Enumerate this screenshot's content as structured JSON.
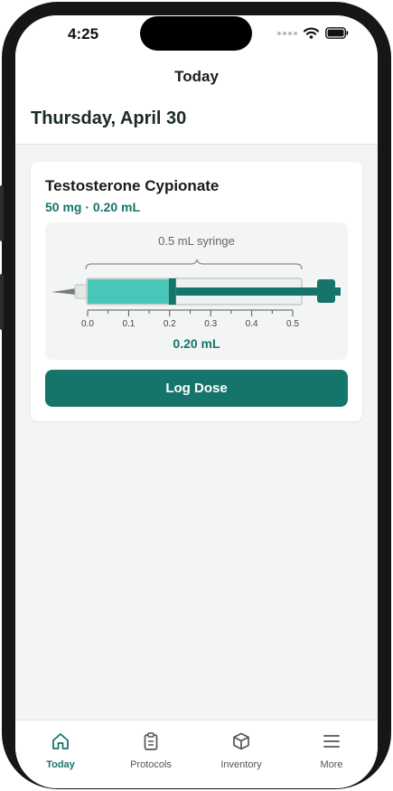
{
  "status": {
    "time": "4:25"
  },
  "nav": {
    "title": "Today"
  },
  "date": "Thursday, April 30",
  "dose_card": {
    "medication": "Testosterone Cypionate",
    "dose_line": "50 mg · 0.20 mL",
    "syringe": {
      "label": "0.5 mL syringe",
      "capacity_ml": 0.5,
      "fill_ml": 0.2,
      "ticks": [
        "0.0",
        "0.1",
        "0.2",
        "0.3",
        "0.4",
        "0.5"
      ],
      "volume_text": "0.20 mL",
      "fill_color": "#4ac6b8",
      "plunger_color": "#16756a"
    },
    "log_button": "Log Dose"
  },
  "tabs": [
    {
      "label": "Today",
      "icon": "home-icon",
      "active": true
    },
    {
      "label": "Protocols",
      "icon": "clipboard-icon",
      "active": false
    },
    {
      "label": "Inventory",
      "icon": "box-icon",
      "active": false
    },
    {
      "label": "More",
      "icon": "menu-icon",
      "active": false
    }
  ],
  "colors": {
    "accent": "#16756a",
    "background": "#f3f5f4"
  }
}
